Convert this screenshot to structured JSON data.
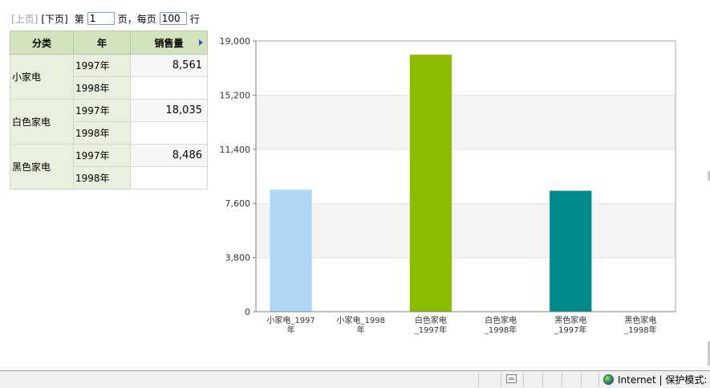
{
  "pager": {
    "prev_label": "[上页]",
    "next_label": "[下页]",
    "page_prefix": "第",
    "page_value": "1",
    "page_suffix": "页，每页",
    "size_value": "100",
    "size_suffix": "行"
  },
  "table": {
    "headers": [
      "分类",
      "年",
      "销售量"
    ],
    "rows": [
      {
        "category": "小家电",
        "y1": "1997年",
        "v1": "8,561",
        "y2": "1998年",
        "v2": ""
      },
      {
        "category": "白色家电",
        "y1": "1997年",
        "v1": "18,035",
        "y2": "1998年",
        "v2": ""
      },
      {
        "category": "黑色家电",
        "y1": "1997年",
        "v1": "8,486",
        "y2": "1998年",
        "v2": ""
      }
    ]
  },
  "chart_data": {
    "type": "bar",
    "categories": [
      "小家电_1997年",
      "小家电_1998年",
      "白色家电_1997年",
      "白色家电_1998年",
      "黑色家电_1997年",
      "黑色家电_1998年"
    ],
    "category_lines": [
      [
        "小家电_1997",
        "年"
      ],
      [
        "小家电_1998",
        "年"
      ],
      [
        "白色家电",
        "_1997年"
      ],
      [
        "白色家电",
        "_1998年"
      ],
      [
        "黑色家电",
        "_1997年"
      ],
      [
        "黑色家电",
        "_1998年"
      ]
    ],
    "values": [
      8561,
      null,
      18035,
      null,
      8486,
      null
    ],
    "bar_colors": [
      "#b0d6f6",
      "#b0d6f6",
      "#8cbc00",
      "#8cbc00",
      "#008b8b",
      "#008b8b"
    ],
    "ylim": [
      0,
      19000
    ],
    "yticks": [
      0,
      3800,
      7600,
      11400,
      15200,
      19000
    ],
    "ytick_labels": [
      "0",
      "3,800",
      "7,600",
      "11,400",
      "15,200",
      "19,000"
    ],
    "title": "",
    "xlabel": "",
    "ylabel": "",
    "grid": true,
    "legend": "none"
  },
  "status": {
    "zone_text": "Internet | 保护模式: 关"
  }
}
